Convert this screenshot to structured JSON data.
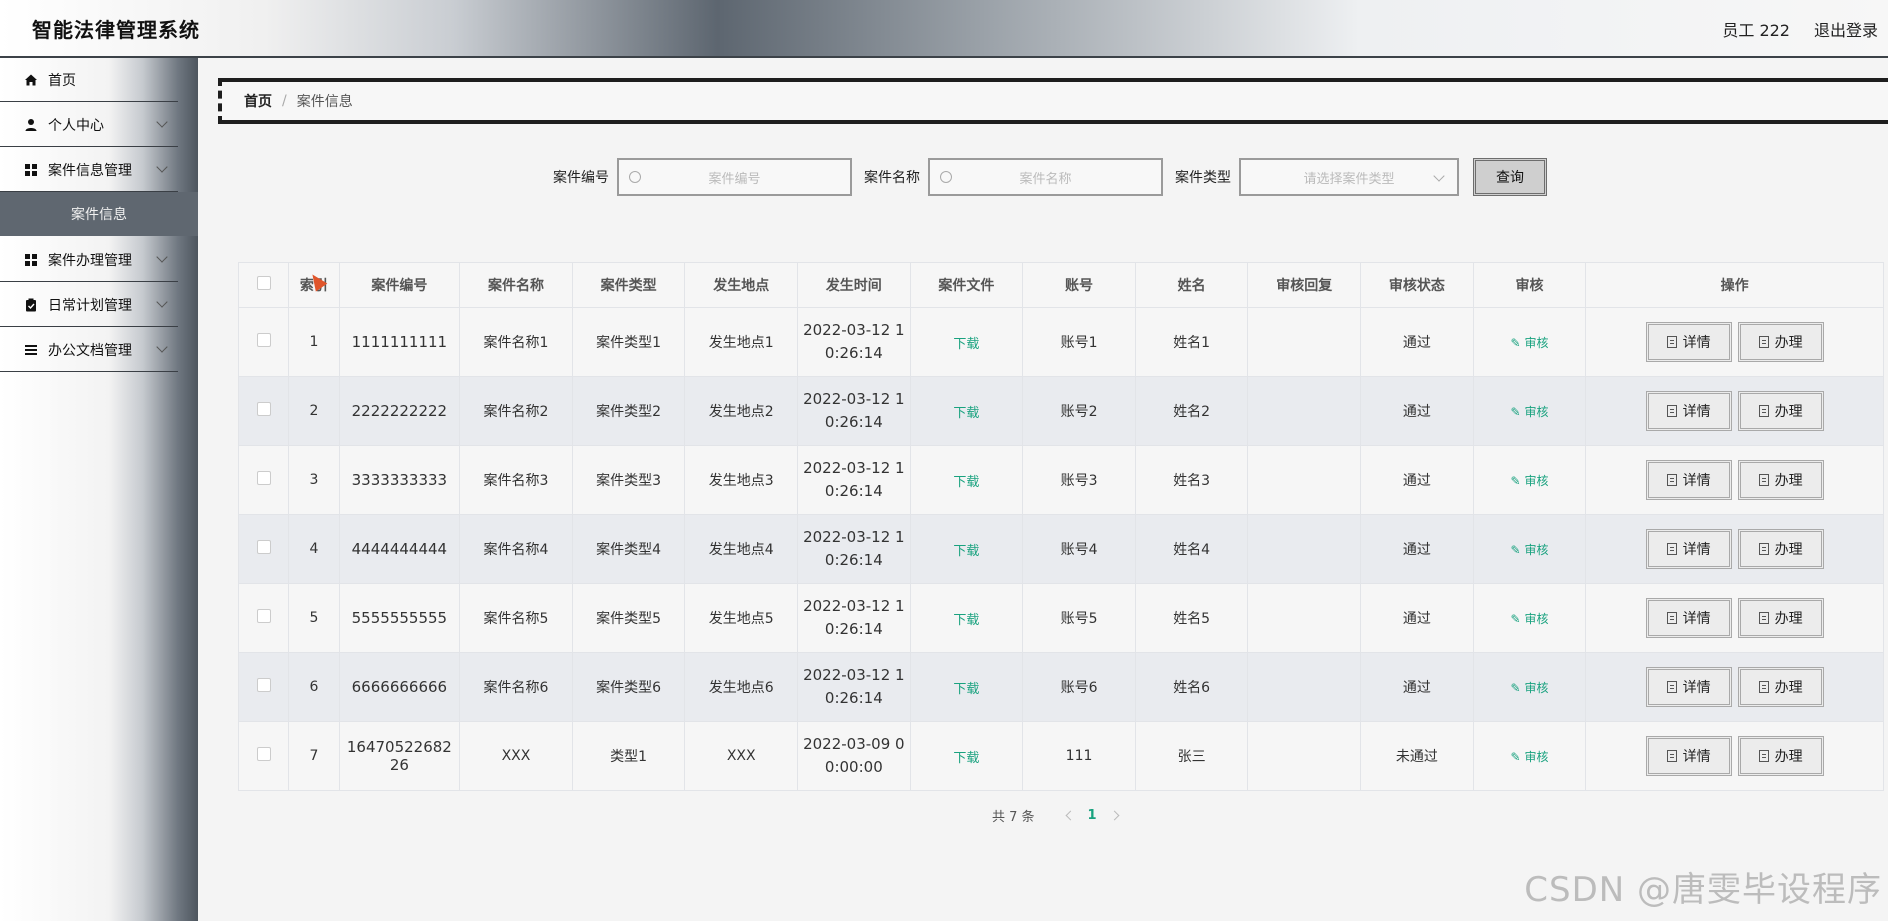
{
  "header": {
    "app_title": "智能法律管理系统",
    "user": "员工 222",
    "logout": "退出登录"
  },
  "sidebar": {
    "items": [
      {
        "label": "首页",
        "icon": "home-icon"
      },
      {
        "label": "个人中心",
        "icon": "user-icon"
      },
      {
        "label": "案件信息管理",
        "icon": "grid-icon"
      },
      {
        "label": "案件办理管理",
        "icon": "grid-icon"
      },
      {
        "label": "日常计划管理",
        "icon": "clipboard-icon"
      },
      {
        "label": "办公文档管理",
        "icon": "list-icon"
      }
    ],
    "active_sub": "案件信息"
  },
  "breadcrumb": {
    "home": "首页",
    "separator": "/",
    "current": "案件信息"
  },
  "search": {
    "case_no_label": "案件编号",
    "case_no_placeholder": "案件编号",
    "case_name_label": "案件名称",
    "case_name_placeholder": "案件名称",
    "case_type_label": "案件类型",
    "case_type_placeholder": "请选择案件类型",
    "query_button": "查询"
  },
  "table": {
    "headers": [
      "",
      "索引",
      "案件编号",
      "案件名称",
      "案件类型",
      "发生地点",
      "发生时间",
      "案件文件",
      "账号",
      "姓名",
      "审核回复",
      "审核状态",
      "审核",
      "操作"
    ],
    "download_label": "下载",
    "audit_label": "审核",
    "detail_label": "详情",
    "handle_label": "办理",
    "rows": [
      {
        "idx": "1",
        "no": "1111111111",
        "name": "案件名称1",
        "type": "案件类型1",
        "place": "发生地点1",
        "time1": "2022-03-12 1",
        "time2": "0:26:14",
        "account": "账号1",
        "person": "姓名1",
        "reply": "",
        "status": "通过"
      },
      {
        "idx": "2",
        "no": "2222222222",
        "name": "案件名称2",
        "type": "案件类型2",
        "place": "发生地点2",
        "time1": "2022-03-12 1",
        "time2": "0:26:14",
        "account": "账号2",
        "person": "姓名2",
        "reply": "",
        "status": "通过"
      },
      {
        "idx": "3",
        "no": "3333333333",
        "name": "案件名称3",
        "type": "案件类型3",
        "place": "发生地点3",
        "time1": "2022-03-12 1",
        "time2": "0:26:14",
        "account": "账号3",
        "person": "姓名3",
        "reply": "",
        "status": "通过"
      },
      {
        "idx": "4",
        "no": "4444444444",
        "name": "案件名称4",
        "type": "案件类型4",
        "place": "发生地点4",
        "time1": "2022-03-12 1",
        "time2": "0:26:14",
        "account": "账号4",
        "person": "姓名4",
        "reply": "",
        "status": "通过"
      },
      {
        "idx": "5",
        "no": "5555555555",
        "name": "案件名称5",
        "type": "案件类型5",
        "place": "发生地点5",
        "time1": "2022-03-12 1",
        "time2": "0:26:14",
        "account": "账号5",
        "person": "姓名5",
        "reply": "",
        "status": "通过"
      },
      {
        "idx": "6",
        "no": "6666666666",
        "name": "案件名称6",
        "type": "案件类型6",
        "place": "发生地点6",
        "time1": "2022-03-12 1",
        "time2": "0:26:14",
        "account": "账号6",
        "person": "姓名6",
        "reply": "",
        "status": "通过"
      },
      {
        "idx": "7",
        "no": "16470522682 26",
        "name": "XXX",
        "type": "类型1",
        "place": "XXX",
        "time1": "2022-03-09 0",
        "time2": "0:00:00",
        "account": "111",
        "person": "张三",
        "reply": "",
        "status": "未通过"
      }
    ]
  },
  "pagination": {
    "total": "共 7 条",
    "current_page": "1"
  },
  "watermark": "CSDN @唐雯毕设程序",
  "colors": {
    "accent": "#19a27f",
    "header_dark": "#3c4248",
    "sidebar_active": "#5f6770"
  }
}
